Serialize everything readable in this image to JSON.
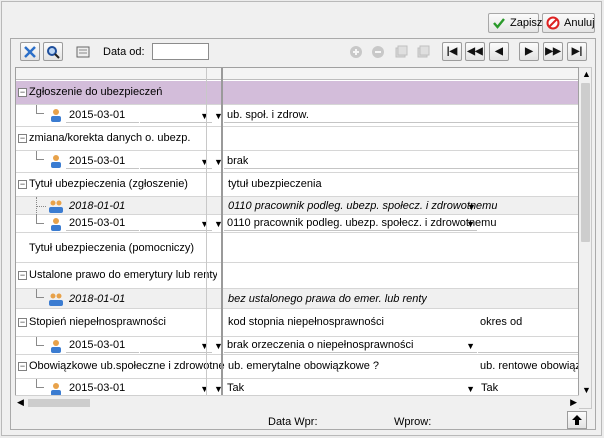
{
  "toolbar": {
    "save_label": "Zapisz",
    "cancel_label": "Anuluj",
    "date_label": "Data od:",
    "date_value": "",
    "nav": [
      "|◀",
      "◀◀",
      "◀",
      "▶",
      "▶▶",
      "▶|"
    ]
  },
  "rows": {
    "g1": {
      "title": "Zgłoszenie do ubezpieczeń",
      "date": "2015-03-01",
      "col2": "ub. społ. i zdrow."
    },
    "g2": {
      "title": "zmiana/korekta danych o. ubezp.",
      "date": "2015-03-01",
      "col2": "brak"
    },
    "g3": {
      "title": "Tytuł ubezpieczenia (zgłoszenie)",
      "col2_header": "tytuł ubezpieczenia",
      "date_hist": "2018-01-01",
      "val_hist": "0110 pracownik podleg. ubezp. społecz. i zdrowotnemu",
      "date": "2015-03-01",
      "val": "0110 pracownik podleg. ubezp. społecz. i zdrowotnemu"
    },
    "g4": {
      "title": "Tytuł ubezpieczenia (pomocniczy)"
    },
    "g5": {
      "title": "Ustalone prawo do emerytury lub renty (z...",
      "date_hist": "2018-01-01",
      "val_hist": "bez ustalonego prawa do emer. lub renty"
    },
    "g6": {
      "title": "Stopień niepełnosprawności",
      "col2_header": "kod stopnia niepełnosprawności",
      "col3_header": "okres od",
      "date": "2015-03-01",
      "val": "brak orzeczenia o niepełnosprawności"
    },
    "g7": {
      "title": "Obowiązkowe ub.społeczne i zdrowotne",
      "col2_header": "ub. emerytalne obowiązkowe ?",
      "col3_header": "ub. rentowe obowiązkowe",
      "date": "2015-03-01",
      "val": "Tak",
      "val3": "Tak"
    }
  },
  "footer": {
    "data_wpr": "Data Wpr:",
    "wprow": "Wprow:"
  }
}
